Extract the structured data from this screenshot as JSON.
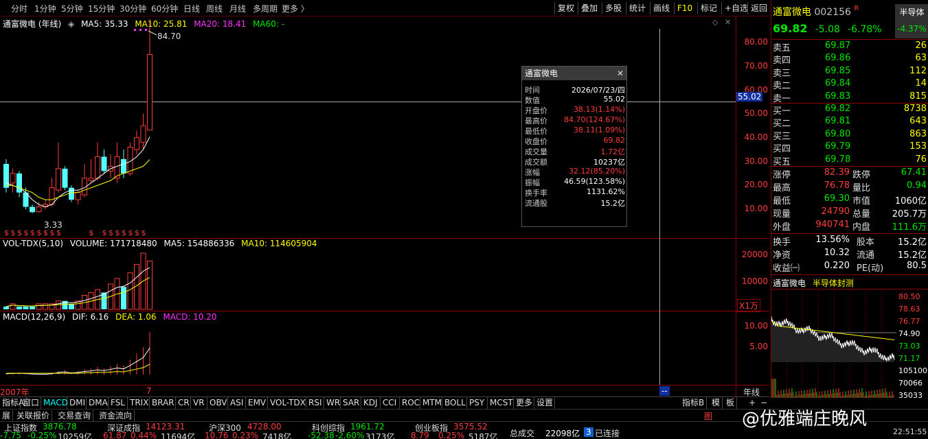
{
  "toolbar": {
    "periods": [
      "分时",
      "1分钟",
      "5分钟",
      "15分钟",
      "30分钟",
      "60分钟",
      "日线",
      "周线",
      "月线",
      "多周期",
      "更多 〉"
    ],
    "buttons": [
      "复权",
      "叠加",
      "多股",
      "统计",
      "画线",
      "F10",
      "标记",
      "+自选",
      "返回"
    ]
  },
  "kline": {
    "title": "通富微电 (年线)",
    "ma5": "MA5: 35.33",
    "ma10": "MA10: 25.81",
    "ma20": "MA20: 18.41",
    "ma60": "MA60: -",
    "high_marker": "84.70",
    "low_marker": "3.33",
    "price_axis": [
      "80.00",
      "70.00",
      "60.00",
      "50.00",
      "40.00",
      "30.00",
      "20.00",
      "10.00"
    ],
    "crosshair_value": "55.02",
    "candles": [
      {
        "o": 24,
        "c": 14,
        "h": 26,
        "l": 12,
        "up": false
      },
      {
        "o": 16,
        "c": 20,
        "h": 22,
        "l": 12,
        "up": true
      },
      {
        "o": 20,
        "c": 12,
        "h": 21,
        "l": 10,
        "up": false
      },
      {
        "o": 12,
        "c": 6,
        "h": 14,
        "l": 5,
        "up": false
      },
      {
        "o": 6,
        "c": 3.8,
        "h": 7,
        "l": 3.33,
        "up": false
      },
      {
        "o": 4,
        "c": 6,
        "h": 8,
        "l": 3.6,
        "up": true
      },
      {
        "o": 6,
        "c": 7,
        "h": 9,
        "l": 5,
        "up": true
      },
      {
        "o": 7,
        "c": 14,
        "h": 18,
        "l": 6,
        "up": true
      },
      {
        "o": 13,
        "c": 22,
        "h": 33,
        "l": 12,
        "up": true
      },
      {
        "o": 22,
        "c": 14,
        "h": 23,
        "l": 13,
        "up": false
      },
      {
        "o": 14,
        "c": 9,
        "h": 15,
        "l": 8,
        "up": false
      },
      {
        "o": 9,
        "c": 12,
        "h": 13,
        "l": 7,
        "up": true
      },
      {
        "o": 11,
        "c": 18,
        "h": 24,
        "l": 10,
        "up": true
      },
      {
        "o": 17,
        "c": 18,
        "h": 26,
        "l": 16,
        "up": true
      },
      {
        "o": 18,
        "c": 27,
        "h": 33,
        "l": 17,
        "up": true
      },
      {
        "o": 27,
        "c": 21,
        "h": 30,
        "l": 20,
        "up": false
      },
      {
        "o": 21,
        "c": 23,
        "h": 28,
        "l": 18,
        "up": true
      },
      {
        "o": 18,
        "c": 27,
        "h": 33,
        "l": 16,
        "up": true
      },
      {
        "o": 26,
        "c": 20,
        "h": 30,
        "l": 18,
        "up": false
      },
      {
        "o": 20,
        "c": 31,
        "h": 33,
        "l": 19,
        "up": true
      },
      {
        "o": 30,
        "c": 35,
        "h": 38,
        "l": 28,
        "up": true
      },
      {
        "o": 33,
        "c": 40,
        "h": 45,
        "l": 30,
        "up": true
      },
      {
        "o": 38.13,
        "c": 69.82,
        "h": 84.7,
        "l": 38.11,
        "up": true
      }
    ],
    "ma5_line": [
      16,
      15,
      14,
      12,
      9,
      7,
      6,
      7,
      10,
      12,
      13,
      13,
      14,
      16,
      18,
      20,
      22,
      23,
      24,
      25,
      27,
      30,
      35.33
    ],
    "ma10_line": [
      15,
      15,
      14,
      13,
      12,
      10,
      9,
      9,
      10,
      11,
      12,
      12,
      13,
      14,
      15,
      16,
      17,
      19,
      20,
      21,
      22,
      23,
      25.81
    ],
    "dividend_marker": "$"
  },
  "volume": {
    "title": "VOL-TDX(5,10)",
    "volume": "VOLUME: 171718480",
    "ma5": "MA5: 154886336",
    "ma10": "MA10: 114605904",
    "axis": [
      "20000",
      "10000"
    ],
    "unit": "X1万",
    "bars": [
      1,
      2,
      1,
      1,
      1,
      2,
      2,
      2,
      3,
      3,
      2,
      3,
      5,
      6,
      7,
      6,
      9,
      11,
      8,
      13,
      16,
      20,
      17.2
    ]
  },
  "macd": {
    "title": "MACD(12,26,9)",
    "dif": "DIF: 6.16",
    "dea": "DEA: 1.06",
    "macd": "MACD: 10.20",
    "axis": [
      "10.00",
      "5.00"
    ],
    "hist": [
      0.3,
      0.4,
      0.5,
      0.4,
      0.2,
      0.1,
      0.1,
      0.3,
      0.8,
      1.0,
      0.6,
      0.8,
      1.2,
      1.4,
      1.8,
      1.5,
      2.0,
      2.5,
      2.2,
      3.5,
      5.0,
      6.5,
      10.2
    ]
  },
  "xaxis": {
    "start": "2007年",
    "end": "7",
    "period_label": "年线",
    "scroll_label": "--"
  },
  "popup": {
    "title": "通富微电",
    "rows": [
      {
        "k": "时间",
        "v": "2026/07/23/四",
        "c": "white"
      },
      {
        "k": "数值",
        "v": "55.02",
        "c": "white"
      },
      {
        "k": "开盘价",
        "v": "38.13(1.14%)",
        "c": "red"
      },
      {
        "k": "最高价",
        "v": "84.70(124.67%)",
        "c": "red"
      },
      {
        "k": "最低价",
        "v": "38.11(1.09%)",
        "c": "red"
      },
      {
        "k": "收盘价",
        "v": "69.82",
        "c": "red"
      },
      {
        "k": "成交量",
        "v": "1.72亿",
        "c": "red"
      },
      {
        "k": "成交额",
        "v": "10237亿",
        "c": "white"
      },
      {
        "k": "涨幅",
        "v": "32.12(85.20%)",
        "c": "red"
      },
      {
        "k": "振幅",
        "v": "46.59(123.58%)",
        "c": "white"
      },
      {
        "k": "换手率",
        "v": "1131.62%",
        "c": "white"
      },
      {
        "k": "流通股",
        "v": "15.2亿",
        "c": "white"
      }
    ]
  },
  "quote": {
    "name": "通富微电",
    "code": "002156",
    "flag": "R",
    "sector": "半导体",
    "sector_change": "-4.37%",
    "price": "69.82",
    "change": "-5.08",
    "change_pct": "-6.78%",
    "asks": [
      {
        "label": "卖五",
        "price": "69.87",
        "vol": "26"
      },
      {
        "label": "卖四",
        "price": "69.86",
        "vol": "63"
      },
      {
        "label": "卖三",
        "price": "69.85",
        "vol": "112"
      },
      {
        "label": "卖二",
        "price": "69.84",
        "vol": "14"
      },
      {
        "label": "卖一",
        "price": "69.83",
        "vol": "815"
      }
    ],
    "bids": [
      {
        "label": "买一",
        "price": "69.82",
        "vol": "8738"
      },
      {
        "label": "买二",
        "price": "69.81",
        "vol": "643"
      },
      {
        "label": "买三",
        "price": "69.80",
        "vol": "863"
      },
      {
        "label": "买四",
        "price": "69.79",
        "vol": "153"
      },
      {
        "label": "买五",
        "price": "69.78",
        "vol": "76"
      }
    ],
    "stats": [
      {
        "k1": "涨停",
        "v1": "82.39",
        "c1": "red",
        "k2": "跌停",
        "v2": "67.41",
        "c2": "green"
      },
      {
        "k1": "最高",
        "v1": "76.78",
        "c1": "red",
        "k2": "量比",
        "v2": "0.94",
        "c2": "green"
      },
      {
        "k1": "最低",
        "v1": "69.30",
        "c1": "green",
        "k2": "市值",
        "v2": "1060亿",
        "c2": "white"
      },
      {
        "k1": "现量",
        "v1": "24790",
        "c1": "red",
        "k2": "总量",
        "v2": "205.7万",
        "c2": "white"
      },
      {
        "k1": "外盘",
        "v1": "940741",
        "c1": "red",
        "k2": "内盘",
        "v2": "111.6万",
        "c2": "green"
      }
    ],
    "stats2": [
      {
        "k1": "换手",
        "v1": "13.56%",
        "k2": "股本",
        "v2": "15.2亿"
      },
      {
        "k1": "净资",
        "v1": "10.32",
        "k2": "流通",
        "v2": "15.2亿"
      },
      {
        "k1": "收益㈠",
        "v1": "0.220",
        "k2": "PE(动)",
        "v2": "80.5"
      }
    ]
  },
  "intraday": {
    "name": "通富微电",
    "tag": "半导体封测",
    "axis": [
      "80.50",
      "78.63",
      "76.77",
      "74.90",
      "73.03",
      "71.17",
      "105100",
      "70066",
      "35033"
    ]
  },
  "tabs": [
    "指标A",
    "窗口",
    "MACD",
    "DMI",
    "DMA",
    "FSL",
    "TRIX",
    "BRAR",
    "CR",
    "VR",
    "OBV",
    "ASI",
    "EMV",
    "VOL-TDX",
    "RSI",
    "WR",
    "SAR",
    "KDJ",
    "CCI",
    "ROC",
    "MTM",
    "BOLL",
    "PSY",
    "MCST",
    "更多",
    "设置"
  ],
  "tabs_right": [
    "指标B",
    "模",
    "板"
  ],
  "tabs_symbols": [
    "+",
    "−"
  ],
  "nav": [
    "展",
    "关联报价",
    "交易查询",
    "资金流向"
  ],
  "nav_right": "图",
  "status": {
    "indices": [
      {
        "name": "上证指数",
        "value": "3876.78",
        "chg": "-7.75",
        "pct": "-0.25%",
        "amt": "10259亿",
        "up": false
      },
      {
        "name": "深证成指",
        "value": "14123.31",
        "chg": "61.87",
        "pct": "0.44%",
        "amt": "11694亿",
        "up": true
      },
      {
        "name": "沪深300",
        "value": "4728.00",
        "chg": "10.76",
        "pct": "0.23%",
        "amt": "7418亿",
        "up": true
      },
      {
        "name": "科创综指",
        "value": "1961.72",
        "chg": "-52.38",
        "pct": "-2.60%",
        "amt": "3173亿",
        "up": false
      },
      {
        "name": "创业板指",
        "value": "3575.52",
        "chg": "8.79",
        "pct": "0.25%",
        "amt": "5187亿",
        "up": true
      }
    ],
    "total_label": "总成交",
    "total_value": "22098亿",
    "conn_count": "3",
    "conn_label": "已连接",
    "time": "22:51:55",
    "watermark": "@优雅端庄晚风"
  }
}
